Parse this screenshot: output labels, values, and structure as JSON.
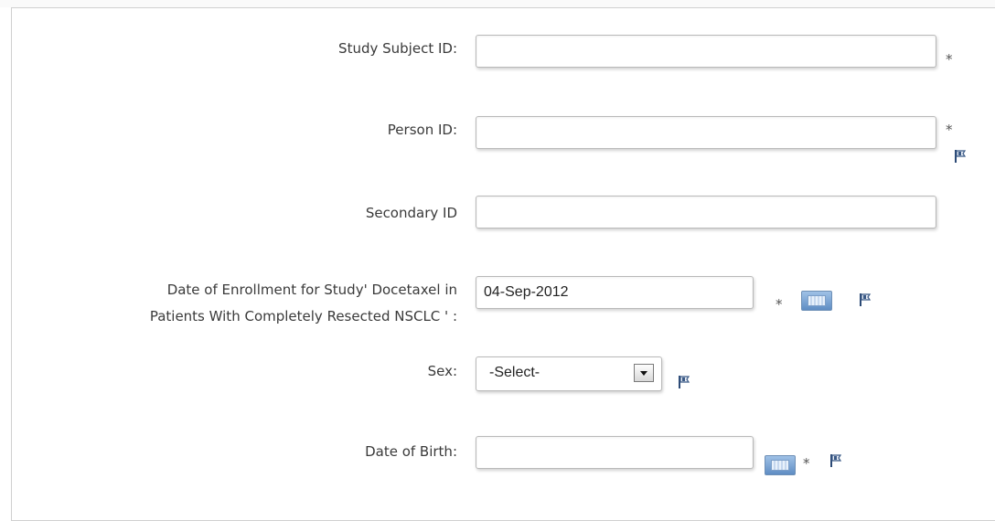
{
  "form": {
    "study_subject_id": {
      "label": "Study Subject ID:",
      "value": "",
      "required": "*"
    },
    "person_id": {
      "label": "Person ID:",
      "value": "",
      "required": "*"
    },
    "secondary_id": {
      "label": "Secondary ID",
      "value": ""
    },
    "enrollment_date": {
      "label_line1": "Date of Enrollment for Study' Docetaxel in",
      "label_line2": "Patients With Completely Resected NSCLC ' :",
      "value": "04-Sep-2012",
      "required": "*"
    },
    "sex": {
      "label": "Sex:",
      "selected": "-Select-"
    },
    "date_of_birth": {
      "label": "Date of Birth:",
      "value": "",
      "required": "*"
    }
  },
  "icons": {
    "flag": "flag-icon",
    "calendar": "calendar-icon",
    "dropdown": "chevron-down-icon"
  },
  "colors": {
    "flag": "#3b5a86",
    "calendar": "#6f9bd0",
    "border": "#b9b9b9"
  }
}
